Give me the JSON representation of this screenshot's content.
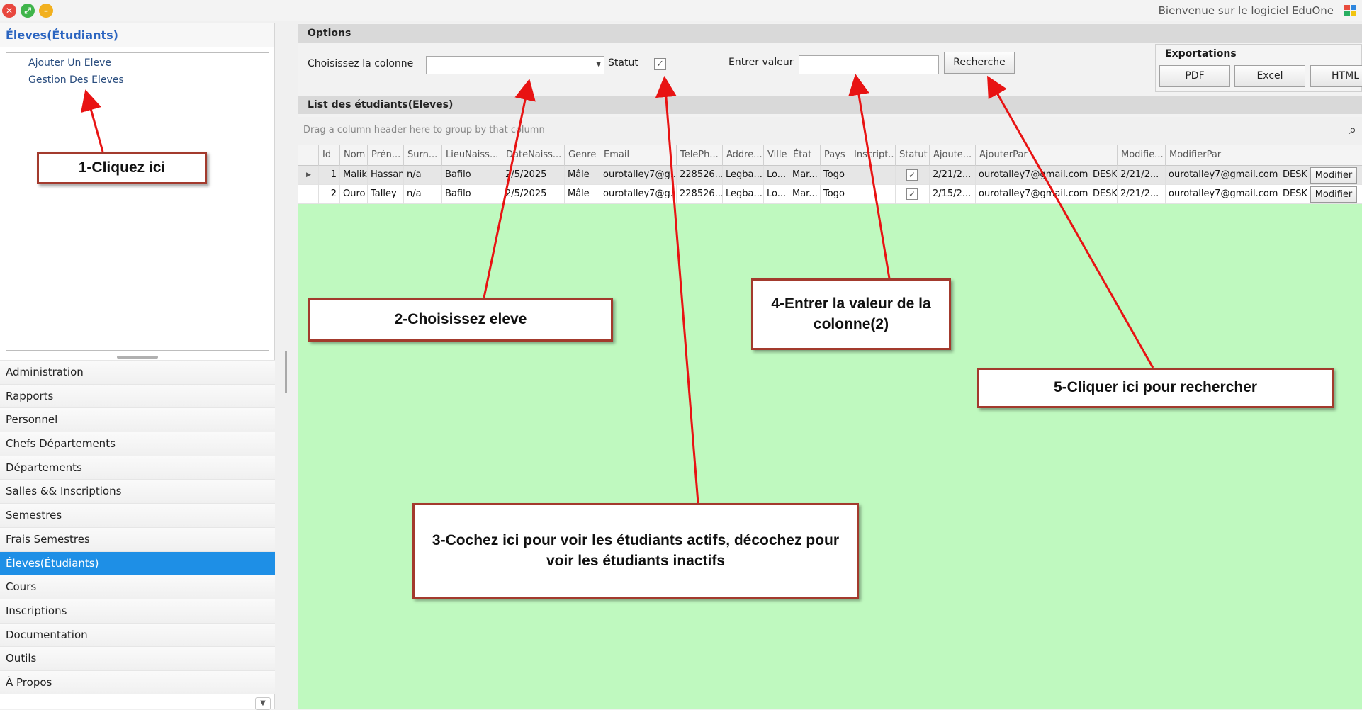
{
  "window": {
    "title": "Bienvenue sur le logiciel EduOne"
  },
  "sidebar": {
    "header": "Éleves(Étudiants)",
    "tree_items": [
      "Ajouter Un Eleve",
      "Gestion Des Eleves"
    ],
    "nav_items": [
      "Administration",
      "Rapports",
      "Personnel",
      "Chefs Départements",
      "Départements",
      "Salles && Inscriptions",
      "Semestres",
      "Frais Semestres",
      "Éleves(Étudiants)",
      "Cours",
      "Inscriptions",
      "Documentation",
      "Outils",
      "À Propos"
    ],
    "active_index": 8
  },
  "options": {
    "group_title": "Options",
    "column_label": "Choisissez la colonne",
    "column_value": "",
    "statut_label": "Statut",
    "statut_checked": true,
    "value_label": "Entrer valeur",
    "value_input": "",
    "search_button": "Recherche"
  },
  "exports": {
    "title": "Exportations",
    "buttons": [
      "PDF",
      "Excel",
      "HTML"
    ]
  },
  "list": {
    "title": "List des étudiants(Eleves)",
    "group_hint": "Drag a column header here to group by that column",
    "columns": [
      "Id",
      "Nom",
      "Prén...",
      "Surn...",
      "LieuNaiss...",
      "DateNaiss...",
      "Genre",
      "Email",
      "TelePh...",
      "Addre...",
      "Ville",
      "État",
      "Pays",
      "Inscript...",
      "Statut",
      "Ajoute...",
      "AjouterPar",
      "Modifie...",
      "ModifierPar",
      ""
    ],
    "rows": [
      {
        "id": "1",
        "nom": "Malik",
        "prenom": "Hassan",
        "surnom": "n/a",
        "lieu": "Bafilo",
        "date": "2/5/2025",
        "genre": "Mâle",
        "email": "ourotalley7@g...",
        "tel": "228526...",
        "adresse": "Legba...",
        "ville": "Lo...",
        "etat": "Mar...",
        "pays": "Togo",
        "inscript": "",
        "statut": true,
        "ajoute": "2/21/2...",
        "ajouterpar": "ourotalley7@gmail.com_DESK...",
        "modifie": "2/21/2...",
        "modifierpar": "ourotalley7@gmail.com_DESK...",
        "action": "Modifier"
      },
      {
        "id": "2",
        "nom": "Ouro",
        "prenom": "Talley",
        "surnom": "n/a",
        "lieu": "Bafilo",
        "date": "2/5/2025",
        "genre": "Mâle",
        "email": "ourotalley7@g...",
        "tel": "228526...",
        "adresse": "Legba...",
        "ville": "Lo...",
        "etat": "Mar...",
        "pays": "Togo",
        "inscript": "",
        "statut": true,
        "ajoute": "2/15/2...",
        "ajouterpar": "ourotalley7@gmail.com_DESK...",
        "modifie": "2/21/2...",
        "modifierpar": "ourotalley7@gmail.com_DESK...",
        "action": "Modifier"
      }
    ]
  },
  "annotations": {
    "a1": "1-Cliquez ici",
    "a2": "2-Choisissez eleve",
    "a3": "3-Cochez ici pour voir les étudiants actifs, décochez pour voir les étudiants inactifs",
    "a4": "4-Entrer la valeur de la colonne(2)",
    "a5": "5-Cliquer ici pour rechercher"
  },
  "colors": {
    "accent": "#1e8fe6",
    "grid_bg": "#bff9bf",
    "annotation_border": "#a33a2d",
    "arrow": "#e81313"
  }
}
